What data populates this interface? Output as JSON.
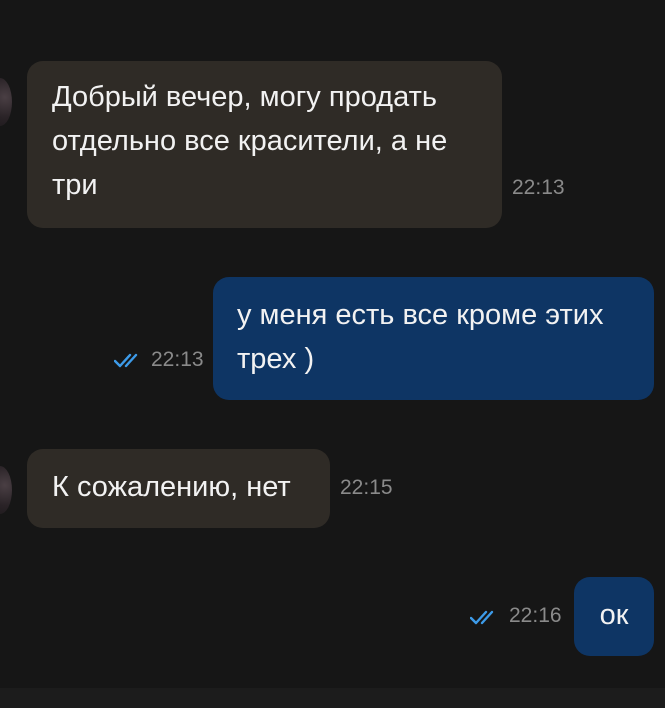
{
  "messages": [
    {
      "direction": "incoming",
      "text": "Добрый вечер, могу продать\nотдельно все красители, а не\nтри",
      "time": "22:13"
    },
    {
      "direction": "outgoing",
      "text": "у меня есть все кроме этих\nтрех )",
      "time": "22:13",
      "status_icon": "double-check-icon"
    },
    {
      "direction": "incoming",
      "text": "К сожалению, нет",
      "time": "22:15"
    },
    {
      "direction": "outgoing",
      "text": "ок",
      "time": "22:16",
      "status_icon": "double-check-icon"
    }
  ],
  "colors": {
    "background": "#161616",
    "incoming_bubble": "#2f2b26",
    "outgoing_bubble": "#0e3564",
    "read_check": "#3d9be9",
    "timestamp": "#8a8a8a"
  }
}
